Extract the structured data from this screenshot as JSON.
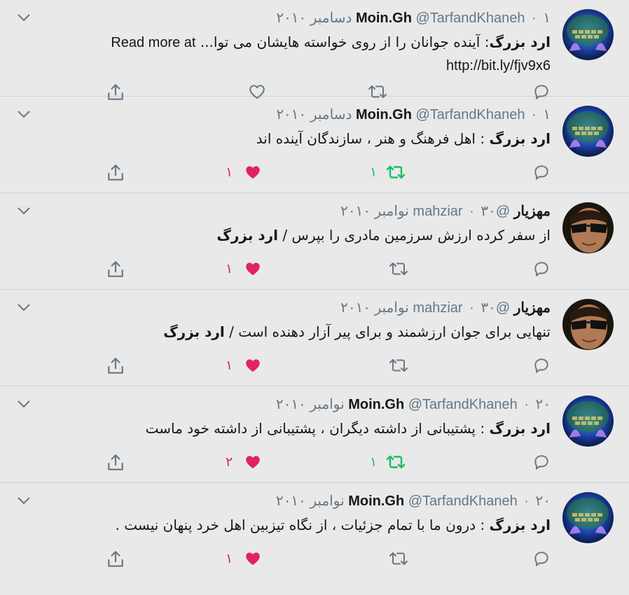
{
  "colors": {
    "background": "#e9e9e9",
    "icon": "#657786",
    "like_active": "#e0245e",
    "retweet_active": "#17bf63",
    "divider": "#c9d3dc"
  },
  "tweets": [
    {
      "name": "Moin.Gh",
      "handle": "@TarfandKhaneh",
      "separator": "·",
      "date": "۱ دسامبر ۲۰۱۰",
      "avatar": "keyboard-avatar",
      "prefix": "ارد بزرگ",
      "text": ": آینده جوانان را از روی خواسته هایشان می توا...",
      "read_more": "Read more at",
      "url": "http://bit.ly/fjv9x6",
      "retweets": "",
      "likes": ""
    },
    {
      "name": "Moin.Gh",
      "handle": "@TarfandKhaneh",
      "separator": "·",
      "date": "۱ دسامبر ۲۰۱۰",
      "avatar": "keyboard-avatar",
      "prefix": "ارد بزرگ",
      "text": " : اهل فرهنگ و هنر ، سازندگان آینده اند",
      "retweets": "۱",
      "likes": "۱"
    },
    {
      "name": "مهزیار",
      "handle": "@mahziar",
      "separator": "·",
      "date": "۳۰ نوامبر ۲۰۱۰",
      "avatar": "sunglasses-avatar",
      "text": "از سفر کرده ارزش سرزمین مادری را بپرس / ",
      "suffix": "ارد بزرگ",
      "retweets": "",
      "likes": "۱"
    },
    {
      "name": "مهزیار",
      "handle": "@mahziar",
      "separator": "·",
      "date": "۳۰ نوامبر ۲۰۱۰",
      "avatar": "sunglasses-avatar",
      "text": "تنهایی برای جوان ارزشمند و برای پیر آزار دهنده است / ",
      "suffix": "ارد بزرگ",
      "retweets": "",
      "likes": "۱"
    },
    {
      "name": "Moin.Gh",
      "handle": "@TarfandKhaneh",
      "separator": "·",
      "date": "۲۰ نوامبر ۲۰۱۰",
      "avatar": "keyboard-avatar",
      "prefix": "ارد بزرگ",
      "text": " : پشتیبانی از داشته دیگران ، پشتیبانی از داشته خود ماست",
      "retweets": "۱",
      "likes": "۲"
    },
    {
      "name": "Moin.Gh",
      "handle": "@TarfandKhaneh",
      "separator": "·",
      "date": "۲۰ نوامبر ۲۰۱۰",
      "avatar": "keyboard-avatar",
      "prefix": "ارد بزرگ",
      "text": " : درون ما با تمام جزئیات ، از نگاه تیزبین اهل خرد پنهان نیست .",
      "retweets": "",
      "likes": "۱"
    }
  ]
}
